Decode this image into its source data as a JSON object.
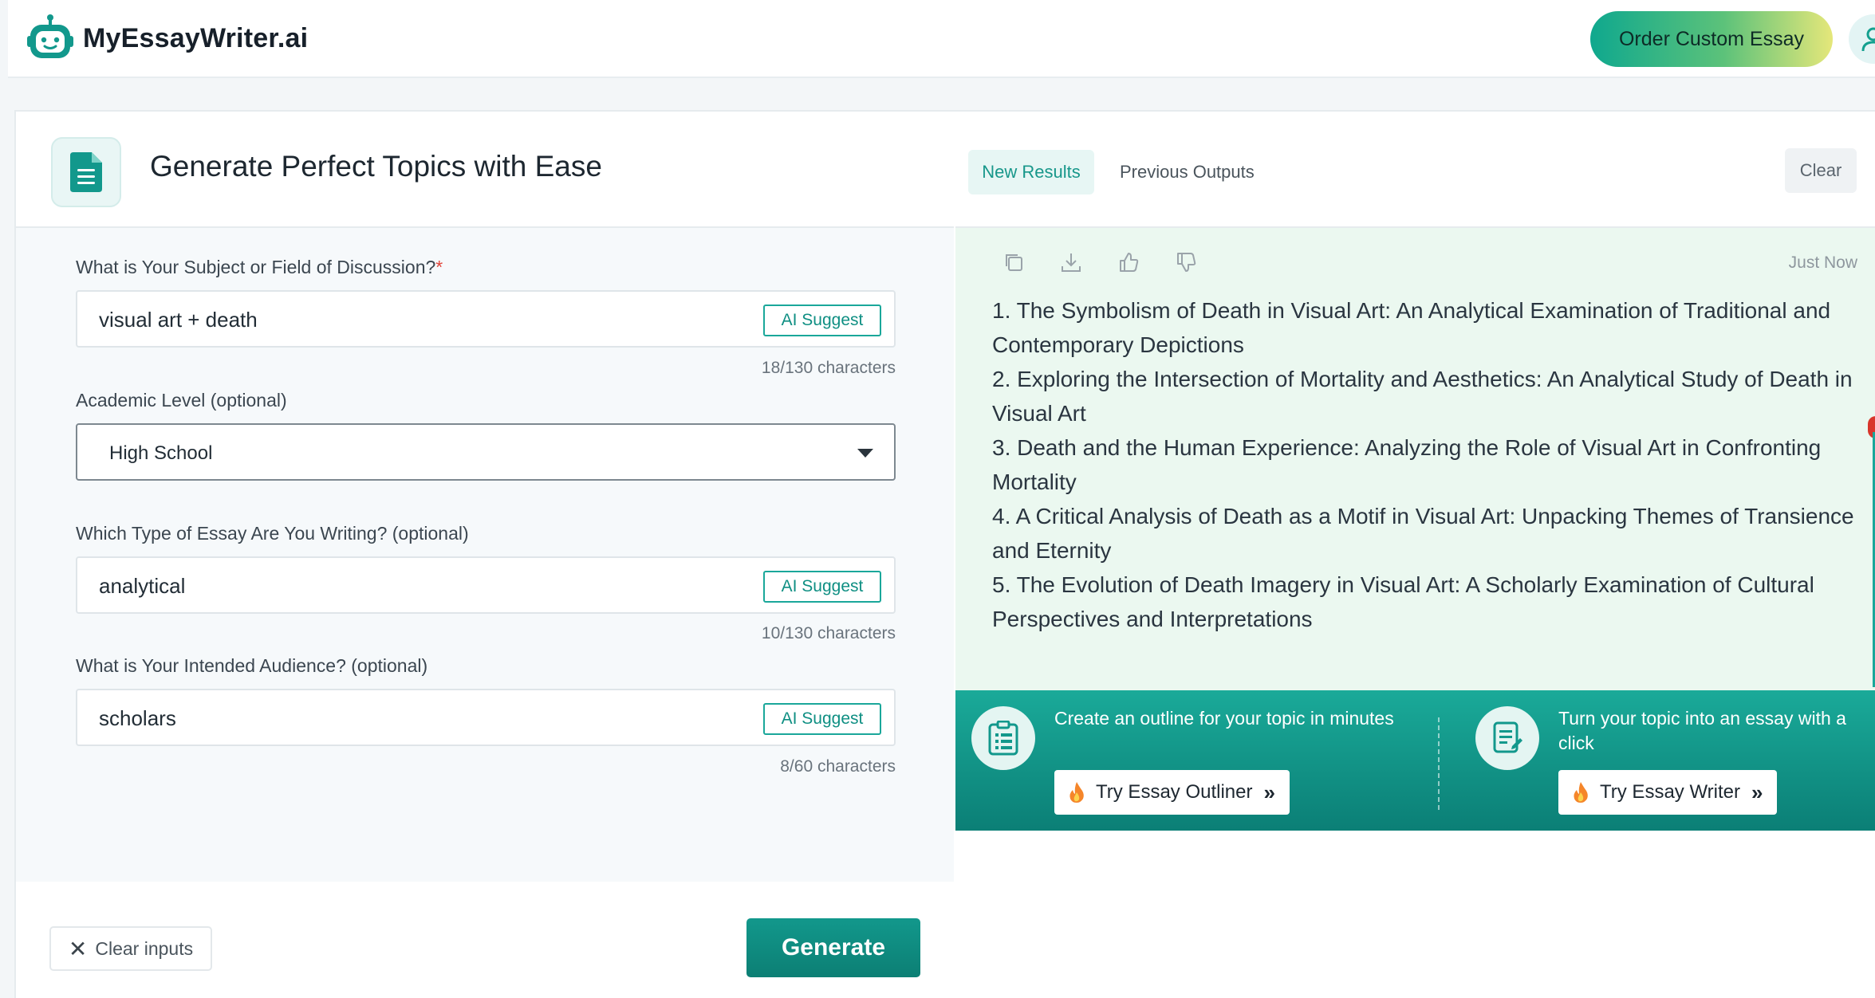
{
  "brand": {
    "name": "MyEssayWriter.ai"
  },
  "header": {
    "order_label": "Order Custom Essay"
  },
  "tool": {
    "title": "Generate Perfect Topics with Ease"
  },
  "form": {
    "subject": {
      "label": "What is Your Subject or Field of Discussion?",
      "required_mark": "*",
      "value": "visual art + death",
      "ai_label": "AI Suggest",
      "counter": "18/130 characters"
    },
    "level": {
      "label": "Academic Level (optional)",
      "value": "High School"
    },
    "essay_type": {
      "label": "Which Type of Essay Are You Writing? (optional)",
      "value": "analytical",
      "ai_label": "AI Suggest",
      "counter": "10/130 characters"
    },
    "audience": {
      "label": "What is Your Intended Audience? (optional)",
      "value": "scholars",
      "ai_label": "AI Suggest",
      "counter": "8/60 characters"
    },
    "clear_label": "Clear inputs",
    "generate_label": "Generate"
  },
  "results": {
    "tabs": [
      "New Results",
      "Previous Outputs"
    ],
    "clear_label": "Clear",
    "timestamp": "Just Now",
    "topics": [
      "1. The Symbolism of Death in Visual Art: An Analytical Examination of Traditional and Contemporary Depictions",
      "2. Exploring the Intersection of Mortality and Aesthetics: An Analytical Study of Death in Visual Art",
      "3. Death and the Human Experience: Analyzing the Role of Visual Art in Confronting Mortality",
      "4. A Critical Analysis of Death as a Motif in Visual Art: Unpacking Themes of Transience and Eternity",
      "5. The Evolution of Death Imagery in Visual Art: A Scholarly Examination of Cultural Perspectives and Interpretations"
    ]
  },
  "promo": [
    {
      "text": "Create an outline for your topic in minutes",
      "button": "Try Essay Outliner"
    },
    {
      "text": "Turn your topic into an essay with a click",
      "button": "Try Essay Writer"
    }
  ],
  "colors": {
    "accent": "#12988c",
    "results_bg": "#ebf8f0",
    "promo_bg": "#0b7f76"
  }
}
